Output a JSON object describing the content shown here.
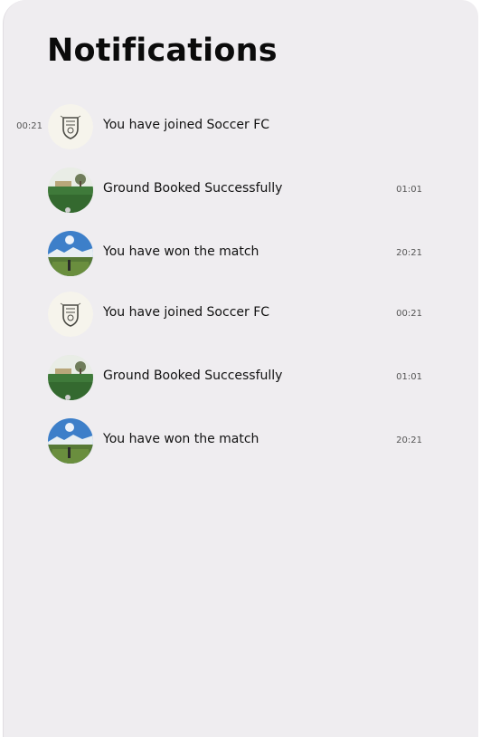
{
  "header": {
    "title": "Notifications"
  },
  "notifications": [
    {
      "message": "You have joined Soccer FC",
      "time": "00:21",
      "avatar_icon": "club-crest-icon"
    },
    {
      "message": "Ground Booked Successfully",
      "time": "01:01",
      "avatar_icon": "ground-photo-icon"
    },
    {
      "message": "You have won the match",
      "time": "20:21",
      "avatar_icon": "match-photo-icon"
    },
    {
      "message": "You have joined Soccer FC",
      "time": "00:21",
      "avatar_icon": "club-crest-icon"
    },
    {
      "message": "Ground Booked Successfully",
      "time": "01:01",
      "avatar_icon": "ground-photo-icon"
    },
    {
      "message": "You have won the match",
      "time": "20:21",
      "avatar_icon": "match-photo-icon"
    }
  ],
  "colors": {
    "panel_background": "#efedf0",
    "title_text": "#0b0b0b",
    "time_text": "#555555"
  }
}
